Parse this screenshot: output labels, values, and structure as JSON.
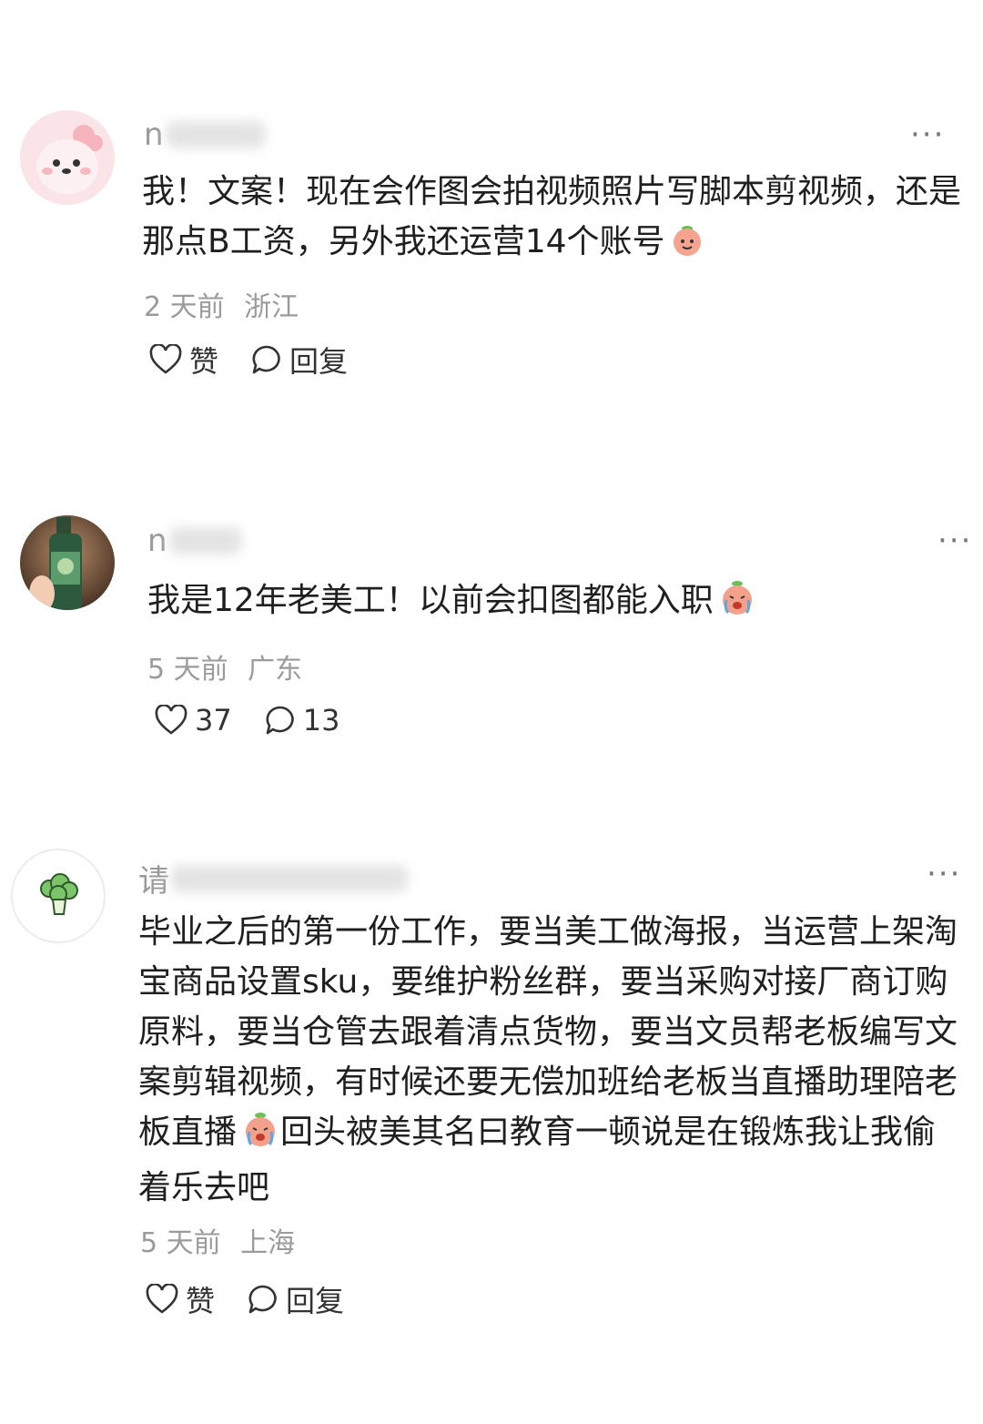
{
  "comments": [
    {
      "username_visible": "n",
      "text": "我！文案！现在会作图会拍视频照片写脚本剪视频，还是那点B工资，另外我还运营14个账号",
      "emoji_icon": "smiling-peach-emoji",
      "time": "2 天前",
      "location": "浙江",
      "like_label": "赞",
      "reply_label": "回复",
      "more_label": "···"
    },
    {
      "username_visible": "n",
      "text": "我是12年老美工！以前会扣图都能入职",
      "emoji_icon": "crying-peach-emoji",
      "time": "5 天前",
      "location": "广东",
      "like_label": "37",
      "reply_label": "13",
      "more_label": "···"
    },
    {
      "username_visible": "请",
      "text_before_emoji": "毕业之后的第一份工作，要当美工做海报，当运营上架淘宝商品设置sku，要维护粉丝群，要当采购对接厂商订购原料，要当仓管去跟着清点货物，要当文员帮老板编写文案剪辑视频，有时候还要无偿加班给老板当直播助理陪老板直播",
      "emoji_icon": "crying-peach-emoji",
      "text_after_emoji": "回头被美其名曰教育一顿说是在锻炼我让我偷着乐去吧",
      "time": "5 天前",
      "location": "上海",
      "like_label": "赞",
      "reply_label": "回复",
      "more_label": "···"
    }
  ]
}
